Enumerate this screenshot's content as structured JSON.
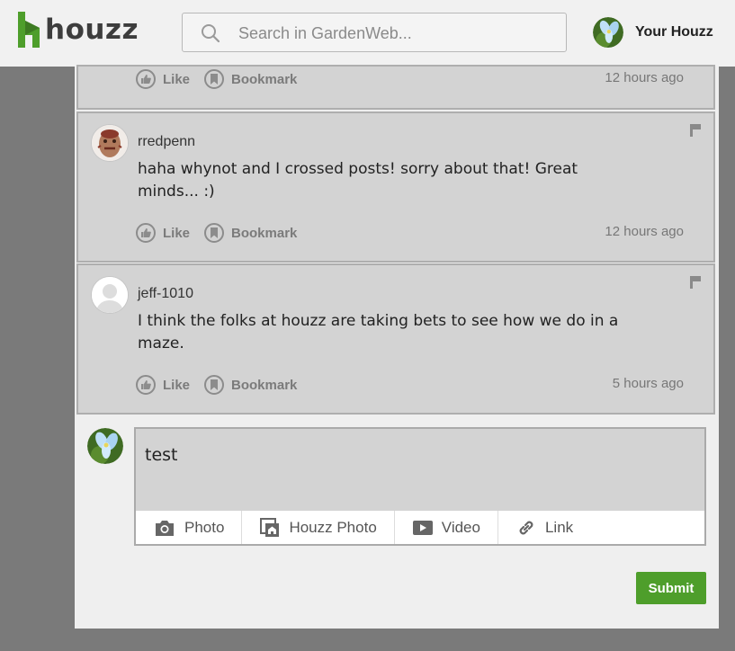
{
  "header": {
    "brand": "houzz",
    "search_placeholder": "Search in GardenWeb...",
    "user_label": "Your Houzz"
  },
  "actions": {
    "like": "Like",
    "bookmark": "Bookmark"
  },
  "posts": [
    {
      "time": "12 hours ago"
    },
    {
      "username": "rredpenn",
      "comment": "haha whynot and I crossed posts! sorry about that! Great minds... :)",
      "time": "12 hours ago"
    },
    {
      "username": "jeff-1010",
      "comment": "I think the folks at houzz are taking bets to see how we do in a maze.",
      "time": "5 hours ago"
    }
  ],
  "composer": {
    "text": "test",
    "tools": [
      "Photo",
      "Houzz Photo",
      "Video",
      "Link"
    ],
    "submit_label": "Submit"
  },
  "colors": {
    "brand_green": "#4e9e2b",
    "panel_gray": "#d3d3d3",
    "backdrop": "#7a7a7a"
  }
}
